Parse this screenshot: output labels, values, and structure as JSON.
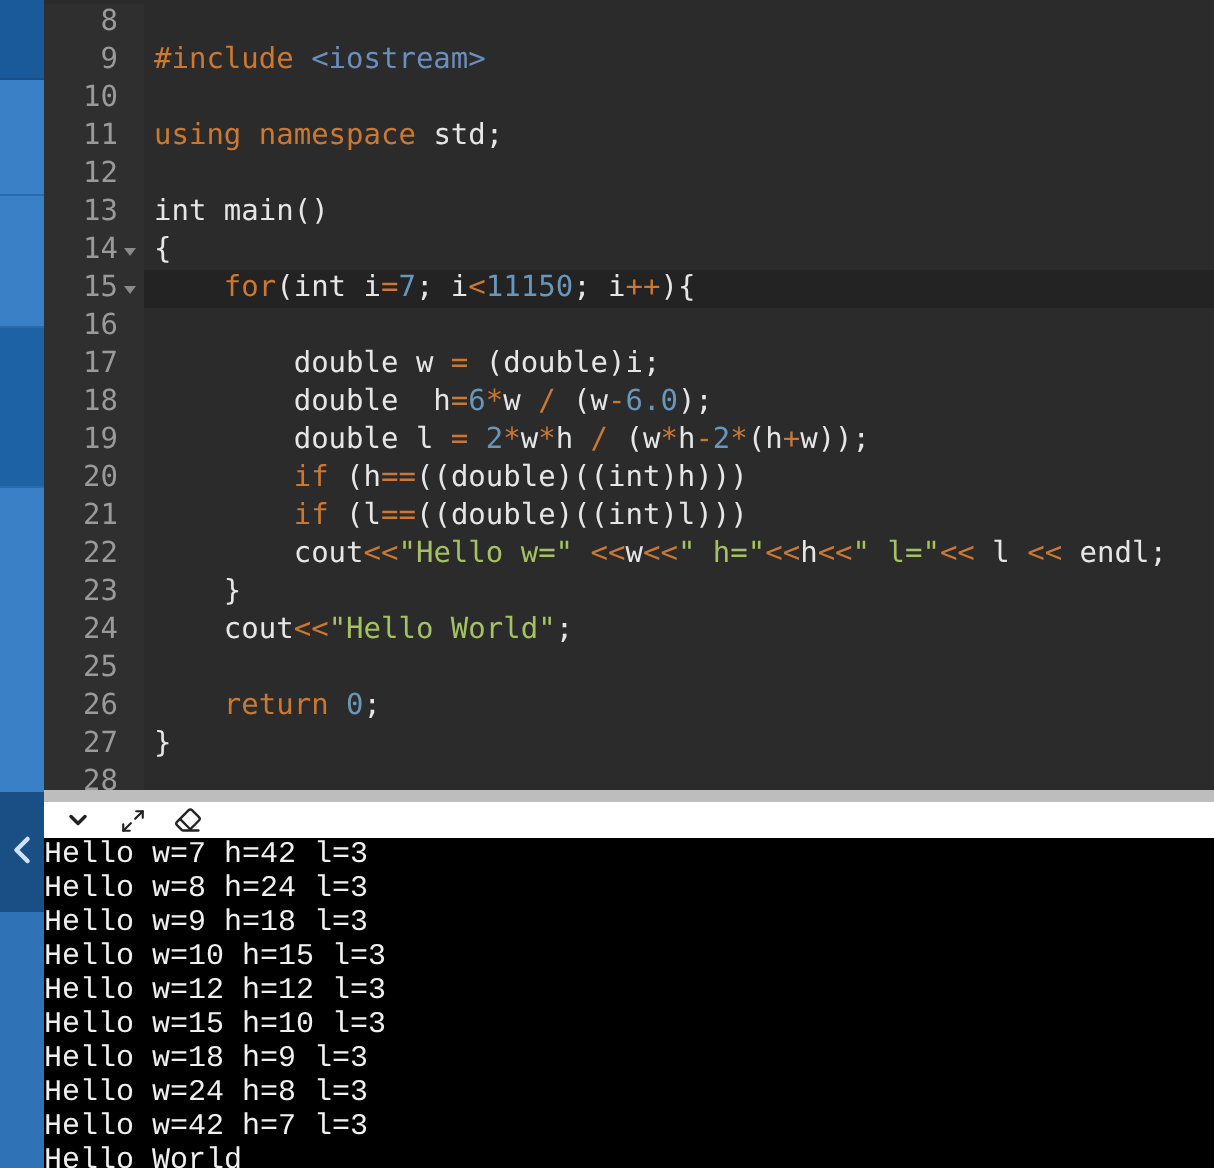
{
  "editor": {
    "lines": [
      {
        "number": "8",
        "fold": false,
        "active": false
      },
      {
        "number": "9",
        "fold": false,
        "active": false,
        "tokens": [
          {
            "kind": "keyword",
            "text": "#include"
          },
          {
            "kind": "include",
            "text": " <iostream>"
          }
        ]
      },
      {
        "number": "10",
        "fold": false,
        "active": false
      },
      {
        "number": "11",
        "fold": false,
        "active": false,
        "tokens": [
          {
            "kind": "keyword",
            "text": "using"
          },
          {
            "kind": "keyword",
            "text": " namespace"
          },
          {
            "kind": "plain",
            "text": " std;"
          }
        ]
      },
      {
        "number": "12",
        "fold": false,
        "active": false
      },
      {
        "number": "13",
        "fold": false,
        "active": false,
        "tokens": [
          {
            "kind": "plain",
            "text": "int main()"
          }
        ]
      },
      {
        "number": "14",
        "fold": true,
        "active": false,
        "tokens": [
          {
            "kind": "plain",
            "text": "{"
          }
        ]
      },
      {
        "number": "15",
        "fold": true,
        "active": true,
        "tokens": [
          {
            "kind": "keyword",
            "text": "    for"
          },
          {
            "kind": "plain",
            "text": "(int i"
          },
          {
            "kind": "operator",
            "text": "="
          },
          {
            "kind": "number",
            "text": "7"
          },
          {
            "kind": "plain",
            "text": "; i"
          },
          {
            "kind": "operator",
            "text": "<"
          },
          {
            "kind": "number",
            "text": "11150"
          },
          {
            "kind": "plain",
            "text": "; i"
          },
          {
            "kind": "operator",
            "text": "++"
          },
          {
            "kind": "plain",
            "text": "){"
          }
        ]
      },
      {
        "number": "16",
        "fold": false,
        "active": false
      },
      {
        "number": "17",
        "fold": false,
        "active": false,
        "tokens": [
          {
            "kind": "plain",
            "text": "        double w "
          },
          {
            "kind": "operator",
            "text": "="
          },
          {
            "kind": "plain",
            "text": " (double)i;"
          }
        ]
      },
      {
        "number": "18",
        "fold": false,
        "active": false,
        "tokens": [
          {
            "kind": "plain",
            "text": "        double  h"
          },
          {
            "kind": "operator",
            "text": "="
          },
          {
            "kind": "number",
            "text": "6"
          },
          {
            "kind": "operator",
            "text": "*"
          },
          {
            "kind": "plain",
            "text": "w "
          },
          {
            "kind": "operator",
            "text": "/"
          },
          {
            "kind": "plain",
            "text": " (w"
          },
          {
            "kind": "operator",
            "text": "-"
          },
          {
            "kind": "number",
            "text": "6.0"
          },
          {
            "kind": "plain",
            "text": ");"
          }
        ]
      },
      {
        "number": "19",
        "fold": false,
        "active": false,
        "tokens": [
          {
            "kind": "plain",
            "text": "        double l "
          },
          {
            "kind": "operator",
            "text": "="
          },
          {
            "kind": "number",
            "text": " 2"
          },
          {
            "kind": "operator",
            "text": "*"
          },
          {
            "kind": "plain",
            "text": "w"
          },
          {
            "kind": "operator",
            "text": "*"
          },
          {
            "kind": "plain",
            "text": "h "
          },
          {
            "kind": "operator",
            "text": "/"
          },
          {
            "kind": "plain",
            "text": " (w"
          },
          {
            "kind": "operator",
            "text": "*"
          },
          {
            "kind": "plain",
            "text": "h"
          },
          {
            "kind": "operator",
            "text": "-"
          },
          {
            "kind": "number",
            "text": "2"
          },
          {
            "kind": "operator",
            "text": "*"
          },
          {
            "kind": "plain",
            "text": "(h"
          },
          {
            "kind": "operator",
            "text": "+"
          },
          {
            "kind": "plain",
            "text": "w));"
          }
        ]
      },
      {
        "number": "20",
        "fold": false,
        "active": false,
        "tokens": [
          {
            "kind": "keyword",
            "text": "        if"
          },
          {
            "kind": "plain",
            "text": " (h"
          },
          {
            "kind": "operator",
            "text": "=="
          },
          {
            "kind": "plain",
            "text": "((double)((int)h)))"
          }
        ]
      },
      {
        "number": "21",
        "fold": false,
        "active": false,
        "tokens": [
          {
            "kind": "keyword",
            "text": "        if"
          },
          {
            "kind": "plain",
            "text": " (l"
          },
          {
            "kind": "operator",
            "text": "=="
          },
          {
            "kind": "plain",
            "text": "((double)((int)l)))"
          }
        ]
      },
      {
        "number": "22",
        "fold": false,
        "active": false,
        "tokens": [
          {
            "kind": "plain",
            "text": "        cout"
          },
          {
            "kind": "operator",
            "text": "<<"
          },
          {
            "kind": "string",
            "text": "\"Hello w=\""
          },
          {
            "kind": "operator",
            "text": " <<"
          },
          {
            "kind": "plain",
            "text": "w"
          },
          {
            "kind": "operator",
            "text": "<<"
          },
          {
            "kind": "string",
            "text": "\" h=\""
          },
          {
            "kind": "operator",
            "text": "<<"
          },
          {
            "kind": "plain",
            "text": "h"
          },
          {
            "kind": "operator",
            "text": "<<"
          },
          {
            "kind": "string",
            "text": "\" l=\""
          },
          {
            "kind": "operator",
            "text": "<<"
          },
          {
            "kind": "plain",
            "text": " l "
          },
          {
            "kind": "operator",
            "text": "<<"
          },
          {
            "kind": "plain",
            "text": " endl;"
          }
        ]
      },
      {
        "number": "23",
        "fold": false,
        "active": false,
        "tokens": [
          {
            "kind": "plain",
            "text": "    }"
          }
        ]
      },
      {
        "number": "24",
        "fold": false,
        "active": false,
        "tokens": [
          {
            "kind": "plain",
            "text": "    cout"
          },
          {
            "kind": "operator",
            "text": "<<"
          },
          {
            "kind": "string",
            "text": "\"Hello World\""
          },
          {
            "kind": "plain",
            "text": ";"
          }
        ]
      },
      {
        "number": "25",
        "fold": false,
        "active": false
      },
      {
        "number": "26",
        "fold": false,
        "active": false,
        "tokens": [
          {
            "kind": "keyword",
            "text": "    return"
          },
          {
            "kind": "number",
            "text": " 0"
          },
          {
            "kind": "plain",
            "text": ";"
          }
        ]
      },
      {
        "number": "27",
        "fold": false,
        "active": false,
        "tokens": [
          {
            "kind": "plain",
            "text": "}"
          }
        ]
      },
      {
        "number": "28",
        "fold": false,
        "active": false
      }
    ]
  },
  "console": {
    "lines": [
      "Hello w=7 h=42 l=3",
      "Hello w=8 h=24 l=3",
      "Hello w=9 h=18 l=3",
      "Hello w=10 h=15 l=3",
      "Hello w=12 h=12 l=3",
      "Hello w=15 h=10 l=3",
      "Hello w=18 h=9 l=3",
      "Hello w=24 h=8 l=3",
      "Hello w=42 h=7 l=3",
      "Hello World"
    ]
  }
}
